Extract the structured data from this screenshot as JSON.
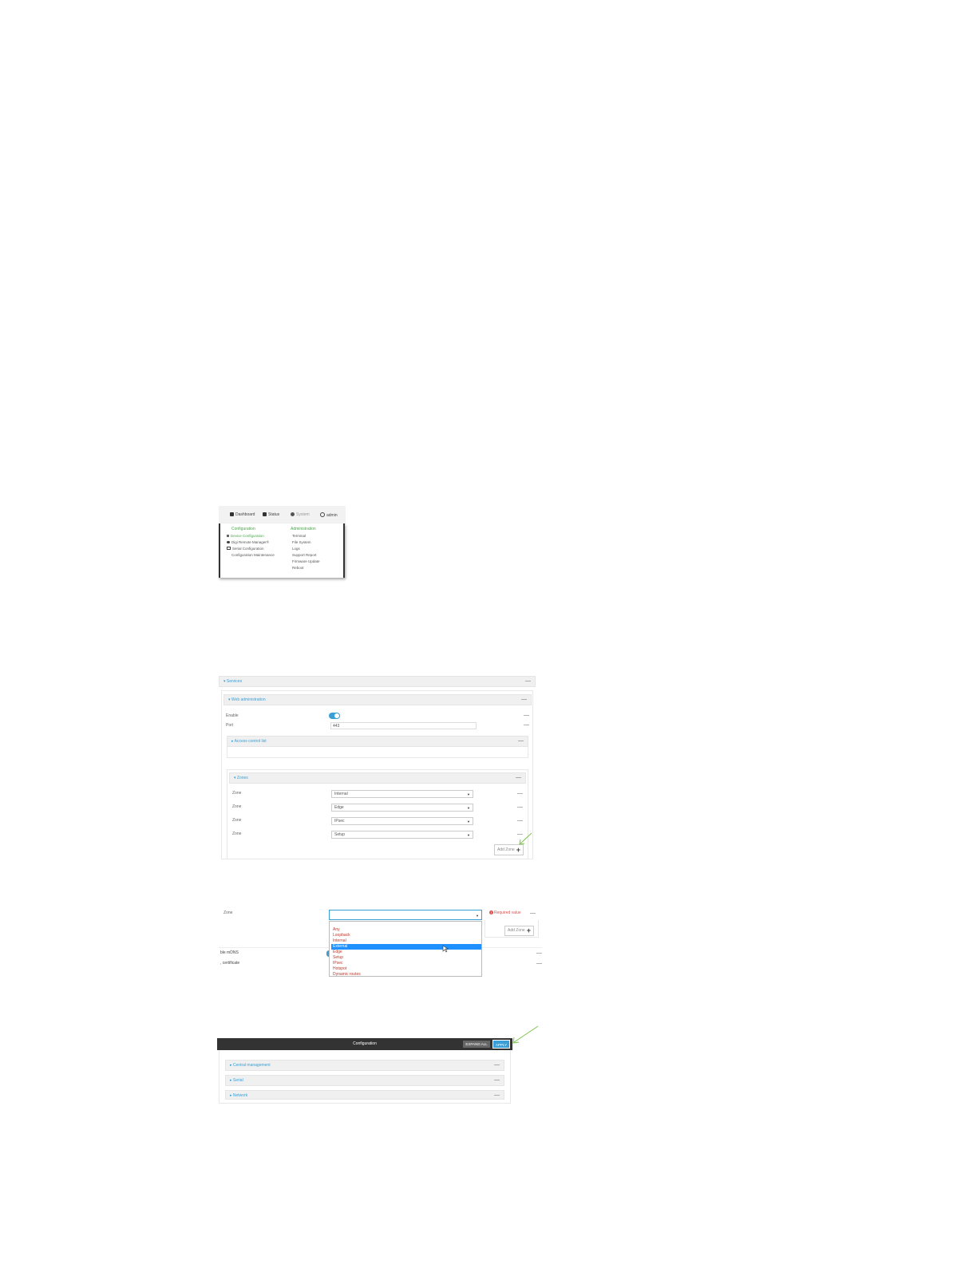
{
  "menu_screenshot": {
    "nav": {
      "dashboard": "Dashboard",
      "status": "Status",
      "system": "System",
      "admin": "admin"
    },
    "configuration_heading": "Configuration",
    "administration_heading": "Administration",
    "configuration_items": [
      "Device Configuration",
      "Digi Remote Manager®",
      "Serial Configuration",
      "Configuration Maintenance"
    ],
    "administration_items": [
      "Terminal",
      "File System",
      "Logs",
      "Support Report",
      "Firmware Update",
      "Reboot"
    ]
  },
  "services_screenshot": {
    "services_label": "Services",
    "web_admin_label": "Web administration",
    "enable_label": "Enable",
    "port_label": "Port",
    "port_value": "443",
    "access_control_label": "Access control list",
    "zones_label": "Zones",
    "zone_rows": [
      {
        "label": "Zone",
        "value": "Internal"
      },
      {
        "label": "Zone",
        "value": "Edge"
      },
      {
        "label": "Zone",
        "value": "IPsec"
      },
      {
        "label": "Zone",
        "value": "Setup"
      }
    ],
    "add_zone_label": "Add Zone",
    "minus_symbol": "—"
  },
  "dropdown_screenshot": {
    "zone_label": "Zone",
    "required_text": "Required value",
    "add_zone_label": "Add Zone",
    "options": [
      "Any",
      "Loopback",
      "Internal",
      "External",
      "Edge",
      "Setup",
      "IPsec",
      "Hotspot",
      "Dynamic routes"
    ],
    "selected_option": "External",
    "behind_row1": "ble mDNS",
    "behind_row2": ", certificate"
  },
  "apply_screenshot": {
    "title": "Configuration",
    "expand_all": "EXPAND ALL",
    "apply": "APPLY",
    "sections": [
      "Central management",
      "Serial",
      "Network"
    ]
  },
  "colors": {
    "accent_blue": "#3a9fd6",
    "menu_green": "#4ca64c",
    "error_red": "#d9534f",
    "arrow_green": "#7dc24b",
    "header_dark": "#333333"
  }
}
